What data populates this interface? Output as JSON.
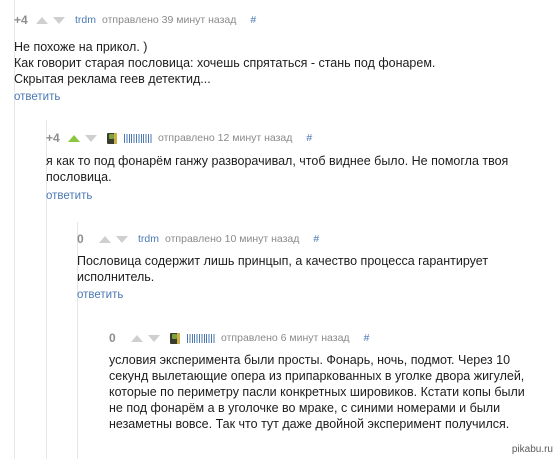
{
  "comments": [
    {
      "rating": "+4",
      "user": "trdm",
      "time": "отправлено 39 минут назад",
      "hash": "#",
      "lines": [
        "Не похоже на прикол. )",
        "Как говорит старая пословица: хочешь спрятаться - стань под фонарем.",
        "Скрытая реклама геев детектид..."
      ],
      "reply": "ответить"
    },
    {
      "rating": "+4",
      "user": "llllllllllllllll",
      "upvoted": true,
      "time": "отправлено 12 минут назад",
      "hash": "#",
      "lines": [
        "я как то под фонарём ганжу разворачивал, чтоб виднее было. Не помогла твоя",
        "пословица."
      ],
      "reply": "ответить"
    },
    {
      "rating": "0",
      "user": "trdm",
      "time": "отправлено 10 минут назад",
      "hash": "#",
      "lines": [
        "Пословица содержит лишь принцып, а качество процесса гарантирует",
        "исполнитель."
      ],
      "reply": "ответить"
    },
    {
      "rating": "0",
      "user": "llllllllllllllll",
      "time": "отправлено 6 минут назад",
      "hash": "#",
      "lines": [
        "условия эксперимента были просты. Фонарь, ночь, подмот. Через 10",
        "секунд вылетающие опера из припаркованных в уголке двора жигулей,",
        "которые по периметру пасли конкретных шировиков. Кстати копы были",
        "не под фонарём а в уголочке во мраке, с синими номерами и были",
        "незаметны вовсе. Так что тут даже двойной эксперимент получился."
      ]
    }
  ],
  "watermark": "pikabu.ru"
}
